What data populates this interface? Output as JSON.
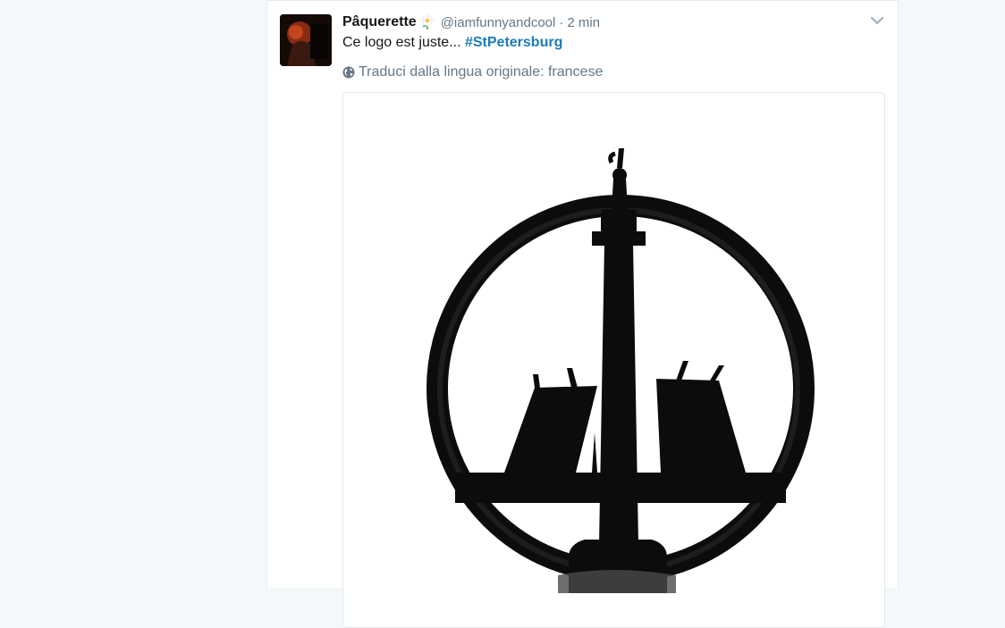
{
  "tweet": {
    "display_name": "Pâquerette",
    "handle": "@iamfunnyandcool",
    "separator": "·",
    "timestamp": "2 min",
    "text_prefix": "Ce logo est juste...",
    "hashtag": "#StPetersburg",
    "translate_label": "Traduci dalla lingua originale: francese"
  },
  "icons": {
    "name_emoji": "daisy-flower-icon",
    "translate": "globe-icon",
    "menu": "chevron-down-icon"
  },
  "colors": {
    "background": "#f5f8fa",
    "card": "#ffffff",
    "name": "#14171a",
    "muted": "#657786",
    "hashtag": "#1c7bb8",
    "logo": "#0c0c0c"
  }
}
